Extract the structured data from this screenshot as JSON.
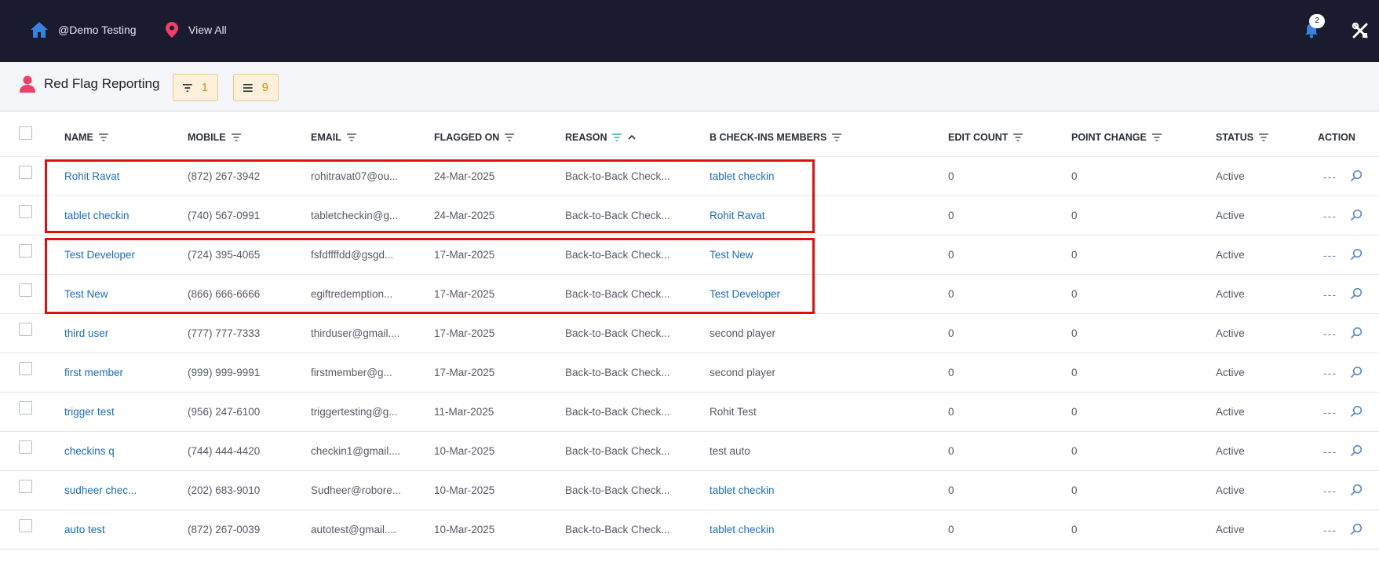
{
  "topbar": {
    "org_label": "@Demo Testing",
    "view_all_label": "View All",
    "notification_count": "2"
  },
  "header": {
    "title": "Red Flag Reporting",
    "filter_count": "1",
    "list_count": "9"
  },
  "table": {
    "columns": [
      "NAME",
      "MOBILE",
      "EMAIL",
      "FLAGGED ON",
      "REASON",
      "B CHECK-INS MEMBERS",
      "EDIT COUNT",
      "POINT CHANGE",
      "STATUS",
      "ACTION"
    ],
    "rows": [
      {
        "name": "Rohit Ravat",
        "mobile": "(872) 267-3942",
        "email": "rohitravat07@ou...",
        "flagged_on": "24-Mar-2025",
        "reason": "Back-to-Back Check...",
        "member": "tablet checkin",
        "member_link": true,
        "edit_count": "0",
        "point_change": "0",
        "status": "Active",
        "action_more": "---"
      },
      {
        "name": "tablet checkin",
        "mobile": "(740) 567-0991",
        "email": "tabletcheckin@g...",
        "flagged_on": "24-Mar-2025",
        "reason": "Back-to-Back Check...",
        "member": "Rohit Ravat",
        "member_link": true,
        "edit_count": "0",
        "point_change": "0",
        "status": "Active",
        "action_more": "---"
      },
      {
        "name": "Test Developer",
        "mobile": "(724) 395-4065",
        "email": "fsfdffffdd@gsgd...",
        "flagged_on": "17-Mar-2025",
        "reason": "Back-to-Back Check...",
        "member": "Test New",
        "member_link": true,
        "edit_count": "0",
        "point_change": "0",
        "status": "Active",
        "action_more": "---"
      },
      {
        "name": "Test New",
        "mobile": "(866) 666-6666",
        "email": "egiftredemption...",
        "flagged_on": "17-Mar-2025",
        "reason": "Back-to-Back Check...",
        "member": "Test Developer",
        "member_link": true,
        "edit_count": "0",
        "point_change": "0",
        "status": "Active",
        "action_more": "---"
      },
      {
        "name": "third user",
        "mobile": "(777) 777-7333",
        "email": "thirduser@gmail....",
        "flagged_on": "17-Mar-2025",
        "reason": "Back-to-Back Check...",
        "member": "second player",
        "member_link": false,
        "edit_count": "0",
        "point_change": "0",
        "status": "Active",
        "action_more": "---"
      },
      {
        "name": "first member",
        "mobile": "(999) 999-9991",
        "email": "firstmember@g...",
        "flagged_on": "17-Mar-2025",
        "reason": "Back-to-Back Check...",
        "member": "second player",
        "member_link": false,
        "edit_count": "0",
        "point_change": "0",
        "status": "Active",
        "action_more": "---"
      },
      {
        "name": "trigger test",
        "mobile": "(956) 247-6100",
        "email": "triggertesting@g...",
        "flagged_on": "11-Mar-2025",
        "reason": "Back-to-Back Check...",
        "member": "Rohit Test",
        "member_link": false,
        "edit_count": "0",
        "point_change": "0",
        "status": "Active",
        "action_more": "---"
      },
      {
        "name": "checkins q",
        "mobile": "(744) 444-4420",
        "email": "checkin1@gmail....",
        "flagged_on": "10-Mar-2025",
        "reason": "Back-to-Back Check...",
        "member": "test auto",
        "member_link": false,
        "edit_count": "0",
        "point_change": "0",
        "status": "Active",
        "action_more": "---"
      },
      {
        "name": "sudheer chec...",
        "mobile": "(202) 683-9010",
        "email": "Sudheer@robore...",
        "flagged_on": "10-Mar-2025",
        "reason": "Back-to-Back Check...",
        "member": "tablet checkin",
        "member_link": true,
        "edit_count": "0",
        "point_change": "0",
        "status": "Active",
        "action_more": "---"
      },
      {
        "name": "auto test",
        "mobile": "(872) 267-0039",
        "email": "autotest@gmail....",
        "flagged_on": "10-Mar-2025",
        "reason": "Back-to-Back Check...",
        "member": "tablet checkin",
        "member_link": true,
        "edit_count": "0",
        "point_change": "0",
        "status": "Active",
        "action_more": "---"
      }
    ]
  },
  "colors": {
    "topbar_bg": "#1a1b2e",
    "link": "#1e6db5",
    "highlight_box": "#e01010",
    "badge_accent": "#e58a10",
    "user_icon": "#ef3f6a"
  }
}
